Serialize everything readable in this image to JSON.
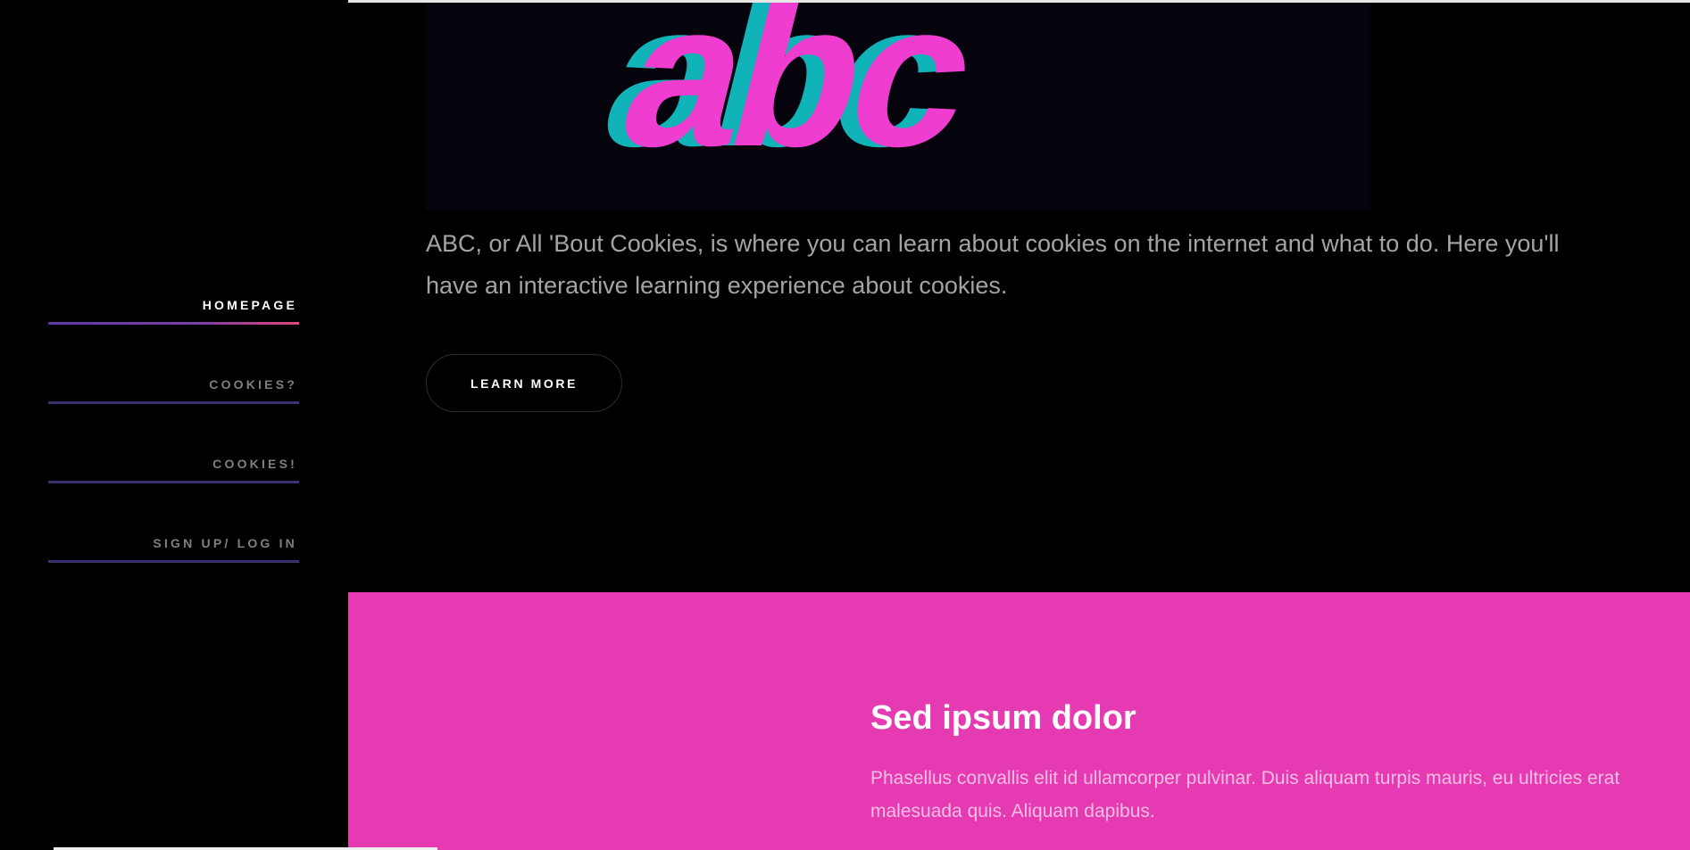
{
  "nav": {
    "items": [
      {
        "label": "HOMEPAGE",
        "active": true
      },
      {
        "label": "COOKIES?",
        "active": false
      },
      {
        "label": "COOKIES!",
        "active": false
      },
      {
        "label": "SIGN UP/ LOG IN",
        "active": false
      }
    ]
  },
  "hero": {
    "logo_text": "abc",
    "description": "ABC, or All 'Bout Cookies, is where you can learn about cookies on the internet and what to do. Here you'll have an interactive learning experience about cookies.",
    "button_label": "LEARN MORE"
  },
  "feature": {
    "title": "Sed ipsum dolor",
    "body": "Phasellus convallis elit id ullamcorper pulvinar. Duis aliquam turpis mauris, eu ultricies erat malesuada quis. Aliquam dapibus."
  },
  "colors": {
    "background": "#000000",
    "accent_pink": "#e53ab1",
    "logo_pink": "#ef3ecf",
    "logo_teal": "#0fb3b8",
    "nav_line": "#3b3170"
  }
}
